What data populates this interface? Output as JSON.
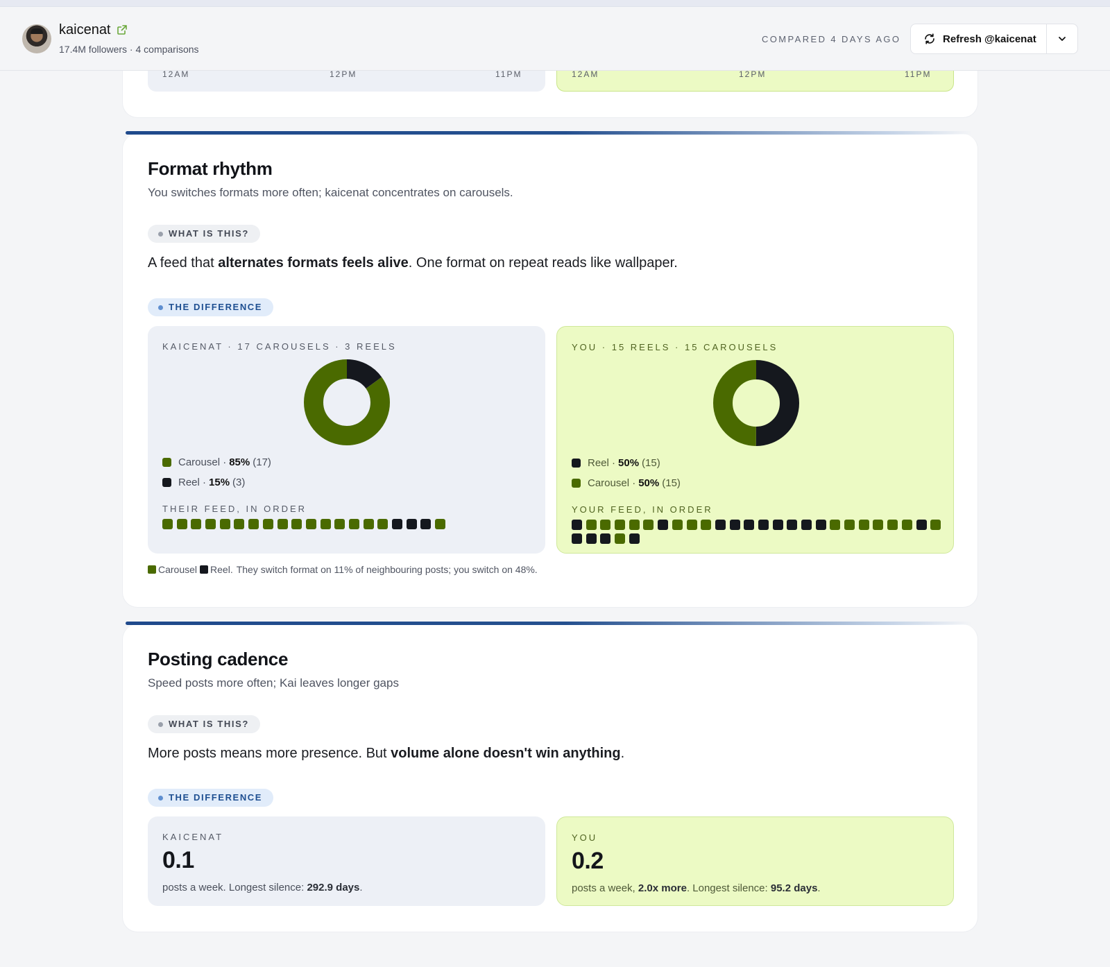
{
  "header": {
    "name": "kaicenat",
    "meta": "17.4M followers · 4 comparisons",
    "compared": "COMPARED 4 DAYS AGO",
    "refresh_label": "Refresh @kaicenat"
  },
  "timeline_remnant": {
    "ticks": [
      "12AM",
      "12PM",
      "11PM"
    ]
  },
  "format_rhythm": {
    "title": "Format rhythm",
    "subtitle": "You switches formats more often; kaicenat concentrates on carousels.",
    "what_label": "WHAT IS THIS?",
    "explain": {
      "pre": "A feed that ",
      "bold": "alternates formats feels alive",
      "post": ". One format on repeat reads like wallpaper."
    },
    "diff_label": "THE DIFFERENCE",
    "them": {
      "heading": "KAICENAT · 17 CAROUSELS · 3 REELS",
      "legend": [
        {
          "label": "Carousel ·",
          "pct": "85%",
          "count": "(17)",
          "type": "carousel"
        },
        {
          "label": "Reel ·",
          "pct": "15%",
          "count": "(3)",
          "type": "reel"
        }
      ],
      "feed_label": "THEIR FEED, IN ORDER",
      "feed": [
        "C",
        "C",
        "C",
        "C",
        "C",
        "C",
        "C",
        "C",
        "C",
        "C",
        "C",
        "C",
        "C",
        "C",
        "C",
        "C",
        "R",
        "R",
        "R",
        "C"
      ]
    },
    "you": {
      "heading": "YOU · 15 REELS · 15 CAROUSELS",
      "legend": [
        {
          "label": "Reel ·",
          "pct": "50%",
          "count": "(15)",
          "type": "reel"
        },
        {
          "label": "Carousel ·",
          "pct": "50%",
          "count": "(15)",
          "type": "carousel"
        }
      ],
      "feed_label": "YOUR FEED, IN ORDER",
      "feed": [
        "R",
        "C",
        "C",
        "C",
        "C",
        "C",
        "R",
        "C",
        "C",
        "C",
        "R",
        "R",
        "R",
        "R",
        "R",
        "R",
        "R",
        "R",
        "C",
        "C",
        "C",
        "C",
        "C",
        "C",
        "R",
        "C",
        "R",
        "R",
        "R",
        "C",
        "R"
      ]
    },
    "footnote": {
      "carousel": "Carousel",
      "reel": "Reel.",
      "text": "They switch format on 11% of neighbouring posts; you switch on 48%."
    }
  },
  "posting_cadence": {
    "title": "Posting cadence",
    "subtitle": "Speed posts more often; Kai leaves longer gaps",
    "what_label": "WHAT IS THIS?",
    "explain": {
      "pre": "More posts means more presence. But ",
      "bold": "volume alone doesn't win anything",
      "post": "."
    },
    "diff_label": "THE DIFFERENCE",
    "them": {
      "heading": "KAICENAT",
      "value": "0.1",
      "text_pre": "posts a week. Longest silence: ",
      "text_bold": "292.9 days",
      "text_post": "."
    },
    "you": {
      "heading": "YOU",
      "value": "0.2",
      "text_pre": "posts a week, ",
      "text_bold1": "2.0x more",
      "text_mid": ". Longest silence: ",
      "text_bold2": "95.2 days",
      "text_post": "."
    }
  },
  "colors": {
    "carousel": "#4a6a00",
    "reel": "#15181e",
    "accent": "#1f4a8c",
    "you_panel": "#ecfac4",
    "them_panel": "#edf0f6"
  },
  "chart_data": [
    {
      "type": "pie",
      "title": "KAICENAT · 17 CAROUSELS · 3 REELS",
      "categories": [
        "Carousel",
        "Reel"
      ],
      "values": [
        17,
        3
      ],
      "percent": [
        85,
        15
      ]
    },
    {
      "type": "pie",
      "title": "YOU · 15 REELS · 15 CAROUSELS",
      "categories": [
        "Reel",
        "Carousel"
      ],
      "values": [
        15,
        15
      ],
      "percent": [
        50,
        50
      ]
    }
  ]
}
